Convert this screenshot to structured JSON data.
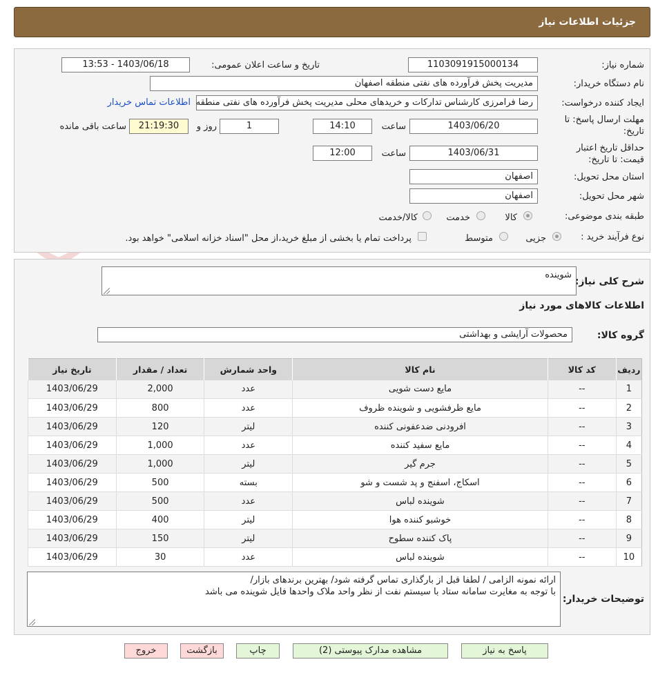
{
  "header": {
    "title": "جزئیات اطلاعات نیاز"
  },
  "watermark": {
    "text": "AriaTender.net"
  },
  "info": {
    "need_number_label": "شماره نیاز:",
    "need_number": "1103091915000134",
    "announce_label": "تاریخ و ساعت اعلان عمومی:",
    "announce_value": "1403/06/18 - 13:53",
    "buyer_label": "نام دستگاه خریدار:",
    "buyer_value": "مدیریت پخش فرآورده های نفتی منطقه اصفهان",
    "requester_label": "ایجاد کننده درخواست:",
    "requester_value": "رضا فرامرزی کارشناس تدارکات و خریدهای محلی مدیریت پخش فرآورده های نفتی منطقه اصفهان",
    "contact_link": "اطلاعات تماس خریدار",
    "deadline_label_1": "مهلت ارسال پاسخ: تا",
    "deadline_label_2": "تاریخ:",
    "deadline_date": "1403/06/20",
    "time_label": "ساعت",
    "deadline_time": "14:10",
    "days_value": "1",
    "days_label": "روز و",
    "remaining_time": "21:19:30",
    "remaining_label": "ساعت باقی مانده",
    "validity_label_1": "حداقل تاریخ اعتبار",
    "validity_label_2": "قیمت: تا تاریخ:",
    "validity_date": "1403/06/31",
    "validity_time": "12:00",
    "province_label": "استان محل تحویل:",
    "province_value": "اصفهان",
    "city_label": "شهر محل تحویل:",
    "city_value": "اصفهان",
    "category_label": "طبقه بندی موضوعی:",
    "category_options": [
      "کالا",
      "خدمت",
      "کالا/خدمت"
    ],
    "process_label": "نوع فرآیند خرید :",
    "process_options": [
      "جزیی",
      "متوسط"
    ],
    "payment_note": "پرداخت تمام یا بخشی از مبلغ خرید،از محل \"اسناد خزانه اسلامی\" خواهد بود."
  },
  "summary": {
    "label": "شرح کلی نیاز:",
    "value": "شوینده",
    "goods_title": "اطلاعات کالاهای مورد نیاز",
    "group_label": "گروه کالا:",
    "group_value": "محصولات آرایشی و بهداشتی"
  },
  "table": {
    "headers": [
      "ردیف",
      "کد کالا",
      "نام کالا",
      "واحد شمارش",
      "تعداد / مقدار",
      "تاریخ نیاز"
    ],
    "rows": [
      [
        "1",
        "--",
        "مایع دست شویی",
        "عدد",
        "2,000",
        "1403/06/29"
      ],
      [
        "2",
        "--",
        "مایع ظرفشویی و شوینده ظروف",
        "عدد",
        "800",
        "1403/06/29"
      ],
      [
        "3",
        "--",
        "افرودنی ضدعفونی کننده",
        "لیتر",
        "120",
        "1403/06/29"
      ],
      [
        "4",
        "--",
        "مایع سفید کننده",
        "عدد",
        "1,000",
        "1403/06/29"
      ],
      [
        "5",
        "--",
        "جرم گیر",
        "لیتر",
        "1,000",
        "1403/06/29"
      ],
      [
        "6",
        "--",
        "اسکاج، اسفنج و پد شست و شو",
        "بسته",
        "500",
        "1403/06/29"
      ],
      [
        "7",
        "--",
        "شوینده لباس",
        "عدد",
        "500",
        "1403/06/29"
      ],
      [
        "8",
        "--",
        "خوشبو کننده هوا",
        "لیتر",
        "400",
        "1403/06/29"
      ],
      [
        "9",
        "--",
        "پاک کننده سطوح",
        "لیتر",
        "150",
        "1403/06/29"
      ],
      [
        "10",
        "--",
        "شوینده لباس",
        "عدد",
        "30",
        "1403/06/29"
      ]
    ]
  },
  "notes": {
    "label": "توضیحات خریدار:",
    "line1": "ارائه نمونه الزامی / لطفا قبل از بارگذاری تماس گرفته شود/ بهترین برندهای بازار/",
    "line2": "با توجه به مغایرت سامانه ستاد با سیستم نفت از نظر واحد ملاک واحدها فایل شوینده می باشد"
  },
  "buttons": {
    "reply": "پاسخ به نیاز",
    "view_docs": "مشاهده مدارک پیوستی (2)",
    "print": "چاپ",
    "back": "بازگشت",
    "exit": "خروج"
  }
}
